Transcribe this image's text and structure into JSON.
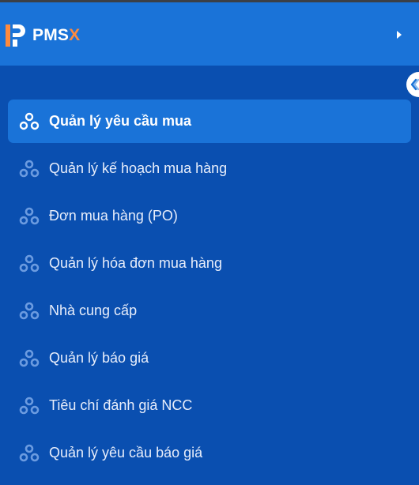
{
  "header": {
    "brand_main": "PMS",
    "brand_accent": "X"
  },
  "colors": {
    "sidebar_bg": "#0a4fb0",
    "header_bg": "#1a73d8",
    "active_item_bg": "#1a73d8",
    "brand_accent": "#ff8a3d",
    "icon_inactive": "#6b9be0"
  },
  "icons": {
    "logo": "pmsx-logo-icon",
    "expand": "caret-right-icon",
    "collapse": "chevron-left-icon",
    "menu_item": "three-circles-icon"
  },
  "menu": {
    "active_index": 0,
    "items": [
      {
        "label": "Quản lý yêu cầu mua"
      },
      {
        "label": "Quản lý kế hoạch mua hàng"
      },
      {
        "label": "Đơn mua hàng (PO)"
      },
      {
        "label": "Quản lý hóa đơn mua hàng"
      },
      {
        "label": "Nhà cung cấp"
      },
      {
        "label": "Quản lý báo giá"
      },
      {
        "label": "Tiêu chí đánh giá NCC"
      },
      {
        "label": "Quản lý yêu cầu báo giá"
      }
    ]
  }
}
